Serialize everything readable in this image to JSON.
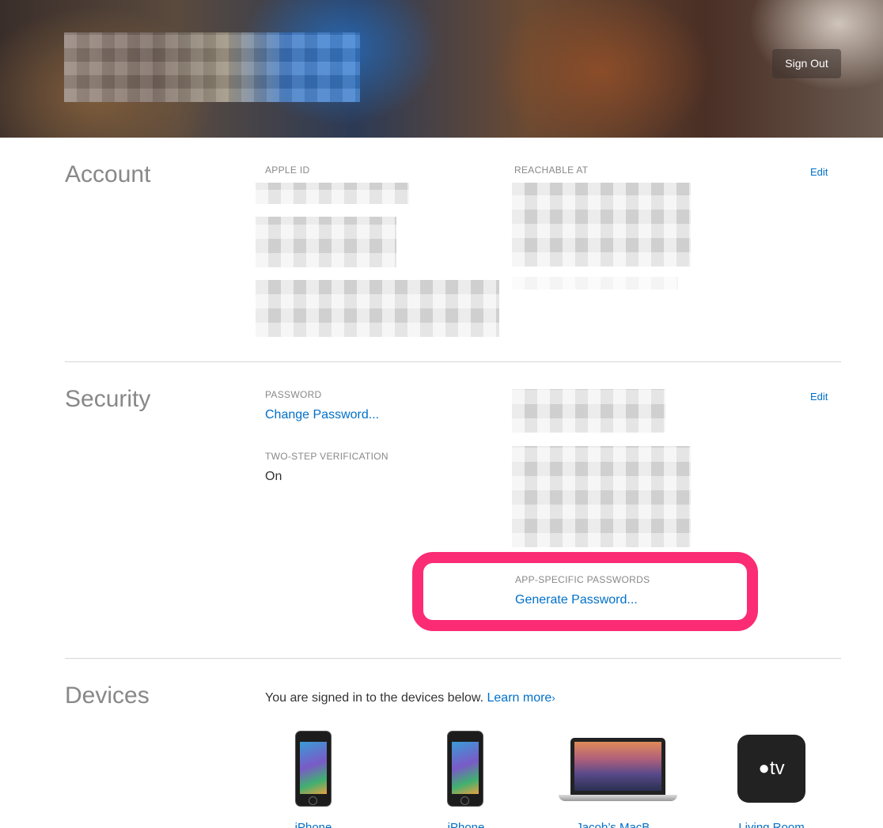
{
  "header": {
    "sign_out_label": "Sign Out"
  },
  "account": {
    "title": "Account",
    "apple_id_label": "APPLE ID",
    "reachable_label": "REACHABLE AT",
    "edit_label": "Edit"
  },
  "security": {
    "title": "Security",
    "edit_label": "Edit",
    "password_label": "PASSWORD",
    "change_password": "Change Password...",
    "two_step_label": "TWO-STEP VERIFICATION",
    "two_step_value": "On",
    "app_specific_label": "APP-SPECIFIC PASSWORDS",
    "generate_password": "Generate Password..."
  },
  "devices": {
    "title": "Devices",
    "intro": "You are signed in to the devices below.",
    "learn_more": "Learn more",
    "learn_more_chevron": "›",
    "items": [
      {
        "label": "iPhone",
        "icon": "iphone-icon"
      },
      {
        "label": "iPhone",
        "icon": "iphone-icon"
      },
      {
        "label": "Jacob’s MacB...",
        "icon": "macbook-icon"
      },
      {
        "label": "Living Room",
        "icon": "apple-tv-icon"
      }
    ],
    "tv_text": "tv"
  },
  "colors": {
    "accent": "#0070c9",
    "highlight": "#fb2c74"
  }
}
